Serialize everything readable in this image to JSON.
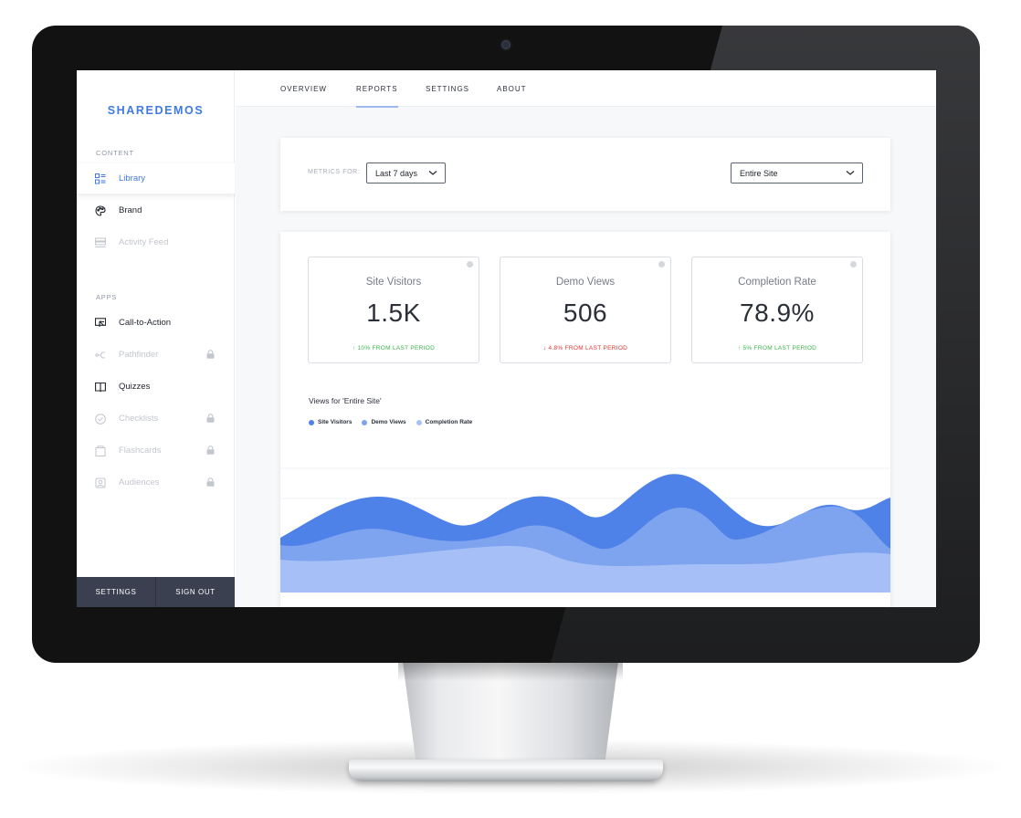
{
  "app": {
    "brand": "SHAREDEMOS"
  },
  "sidebar": {
    "content_label": "CONTENT",
    "content_items": [
      {
        "label": "Library",
        "icon": "library-icon",
        "state": "active"
      },
      {
        "label": "Brand",
        "icon": "palette-icon",
        "state": "normal"
      },
      {
        "label": "Activity Feed",
        "icon": "activity-feed-icon",
        "state": "disabled"
      }
    ],
    "apps_label": "APPS",
    "app_items": [
      {
        "label": "Call-to-Action",
        "icon": "call-to-action-icon",
        "locked": false
      },
      {
        "label": "Pathfinder",
        "icon": "pathfinder-icon",
        "locked": true
      },
      {
        "label": "Quizzes",
        "icon": "book-icon",
        "locked": false
      },
      {
        "label": "Checklists",
        "icon": "check-circle-icon",
        "locked": true
      },
      {
        "label": "Flashcards",
        "icon": "flashcards-icon",
        "locked": true
      },
      {
        "label": "Audiences",
        "icon": "audiences-icon",
        "locked": true
      }
    ],
    "footer": {
      "settings": "SETTINGS",
      "sign_out": "SIGN OUT"
    }
  },
  "topnav": {
    "tabs": [
      {
        "label": "OVERVIEW",
        "active": false
      },
      {
        "label": "REPORTS",
        "active": true
      },
      {
        "label": "SETTINGS",
        "active": false
      },
      {
        "label": "ABOUT",
        "active": false
      }
    ]
  },
  "filters": {
    "metrics_for_label": "METRICS FOR:",
    "period": "Last 7 days",
    "scope": "Entire Site"
  },
  "stats": [
    {
      "title": "Site Visitors",
      "value": "1.5K",
      "delta": "↑ 10% FROM LAST PERIOD",
      "trend": "up"
    },
    {
      "title": "Demo Views",
      "value": "506",
      "delta": "↓ 4.8% FROM LAST PERIOD",
      "trend": "down"
    },
    {
      "title": "Completion Rate",
      "value": "78.9%",
      "delta": "↑ 5% FROM LAST PERIOD",
      "trend": "up"
    }
  ],
  "chart": {
    "title": "Views for 'Entire Site'",
    "legend": [
      {
        "name": "Site Visitors",
        "color": "#4f82e8"
      },
      {
        "name": "Demo Views",
        "color": "#7ea4ef"
      },
      {
        "name": "Completion Rate",
        "color": "#a9c1f6"
      }
    ]
  },
  "colors": {
    "accent": "#3f7ae0",
    "footer_bg": "#3b4050",
    "up": "#39b54a",
    "down": "#e0342f"
  }
}
